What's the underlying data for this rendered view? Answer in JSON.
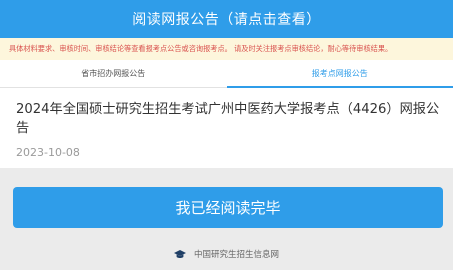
{
  "header": {
    "title": "阅读网报公告（请点击查看）"
  },
  "notice": {
    "text": "具体材料要求、审核时间、审核结论等查看报考点公告或咨询报考点。 请及时关注报考点审核结论，耐心等待审核结果。"
  },
  "tabs": [
    {
      "label": "省市招办网报公告",
      "active": false
    },
    {
      "label": "报考点网报公告",
      "active": true
    }
  ],
  "announcement": {
    "title": "2024年全国硕士研究生招生考试广州中医药大学报考点（4426）网报公告",
    "date": "2023-10-08"
  },
  "confirm_button": {
    "label": "我已经阅读完毕"
  },
  "footer": {
    "icon": "graduation-cap-icon",
    "text": "中国研究生招生信息网"
  },
  "colors": {
    "primary": "#2f9de9",
    "notice_bg": "#fdf6dc",
    "notice_text": "#d9534f",
    "page_bg": "#ebebeb"
  }
}
